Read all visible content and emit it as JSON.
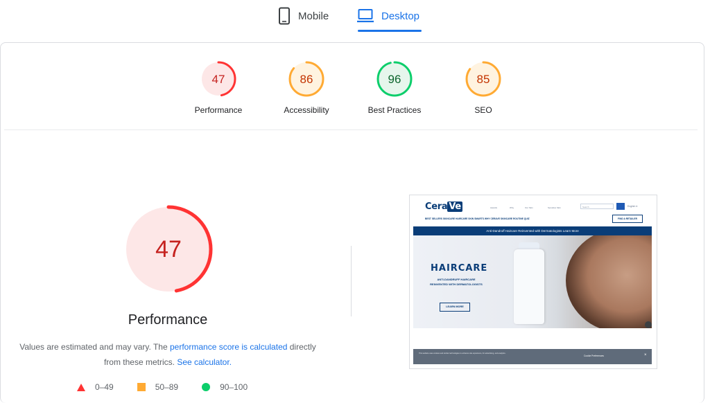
{
  "tabs": [
    {
      "label": "Mobile",
      "icon": "mobile-phone-icon",
      "selected": false
    },
    {
      "label": "Desktop",
      "icon": "laptop-icon",
      "selected": true
    }
  ],
  "categories": [
    {
      "label": "Performance",
      "score": "47",
      "value": 47,
      "rating": "fail",
      "color": "#ff3333",
      "bg": "#fde7e7",
      "text": "#c5221f"
    },
    {
      "label": "Accessibility",
      "score": "86",
      "value": 86,
      "rating": "average",
      "color": "#ffaa33",
      "bg": "#fff3e0",
      "text": "#c33300"
    },
    {
      "label": "Best Practices",
      "score": "96",
      "value": 96,
      "rating": "pass",
      "color": "#0cce6b",
      "bg": "#e6f6ec",
      "text": "#0d652d"
    },
    {
      "label": "SEO",
      "score": "85",
      "value": 85,
      "rating": "average",
      "color": "#ffaa33",
      "bg": "#fff3e0",
      "text": "#c33300"
    }
  ],
  "main": {
    "score": "47",
    "value": 47,
    "title": "Performance",
    "desc_prefix": "Values are estimated and may vary. The ",
    "desc_link1": "performance score is calculated",
    "desc_mid": " directly from these metrics. ",
    "desc_link2": "See calculator.",
    "legend": [
      {
        "range": "0–49",
        "shape": "triangle",
        "color": "#ff3333"
      },
      {
        "range": "50–89",
        "shape": "square",
        "color": "#ffaa33"
      },
      {
        "range": "90–100",
        "shape": "circle",
        "color": "#0cce6b"
      }
    ]
  },
  "screenshot": {
    "logo_a": "Cera",
    "logo_b": "Ve",
    "topnav": [
      "Awards",
      "Why",
      "Our Skin",
      "Sensitive Skin"
    ],
    "search_placeholder": "Search",
    "language": "English ▾",
    "mainnav": "BEST SELLERS    SKINCARE    HAIRCARE    SKIN SMARTS    WHY CERAVE    SKINCARE ROUTINE QUIZ",
    "find_retailer": "FIND A RETAILER",
    "banner": "Anti-Dandruff Haircare Reinvented with Dermatologists Learn More",
    "hero_heading": "HAIRCARE",
    "hero_sub": "ANTI-DANDRUFF HAIRCARE REINVENTED WITH DERMATOLOGISTS",
    "hero_button": "LEARN MORE",
    "cookie_text": "This website uses cookies and similar technologies to enhance site experience, for advertising, and analytics.",
    "cookie_link": "Cookie Preferences",
    "cookie_close": "×"
  }
}
